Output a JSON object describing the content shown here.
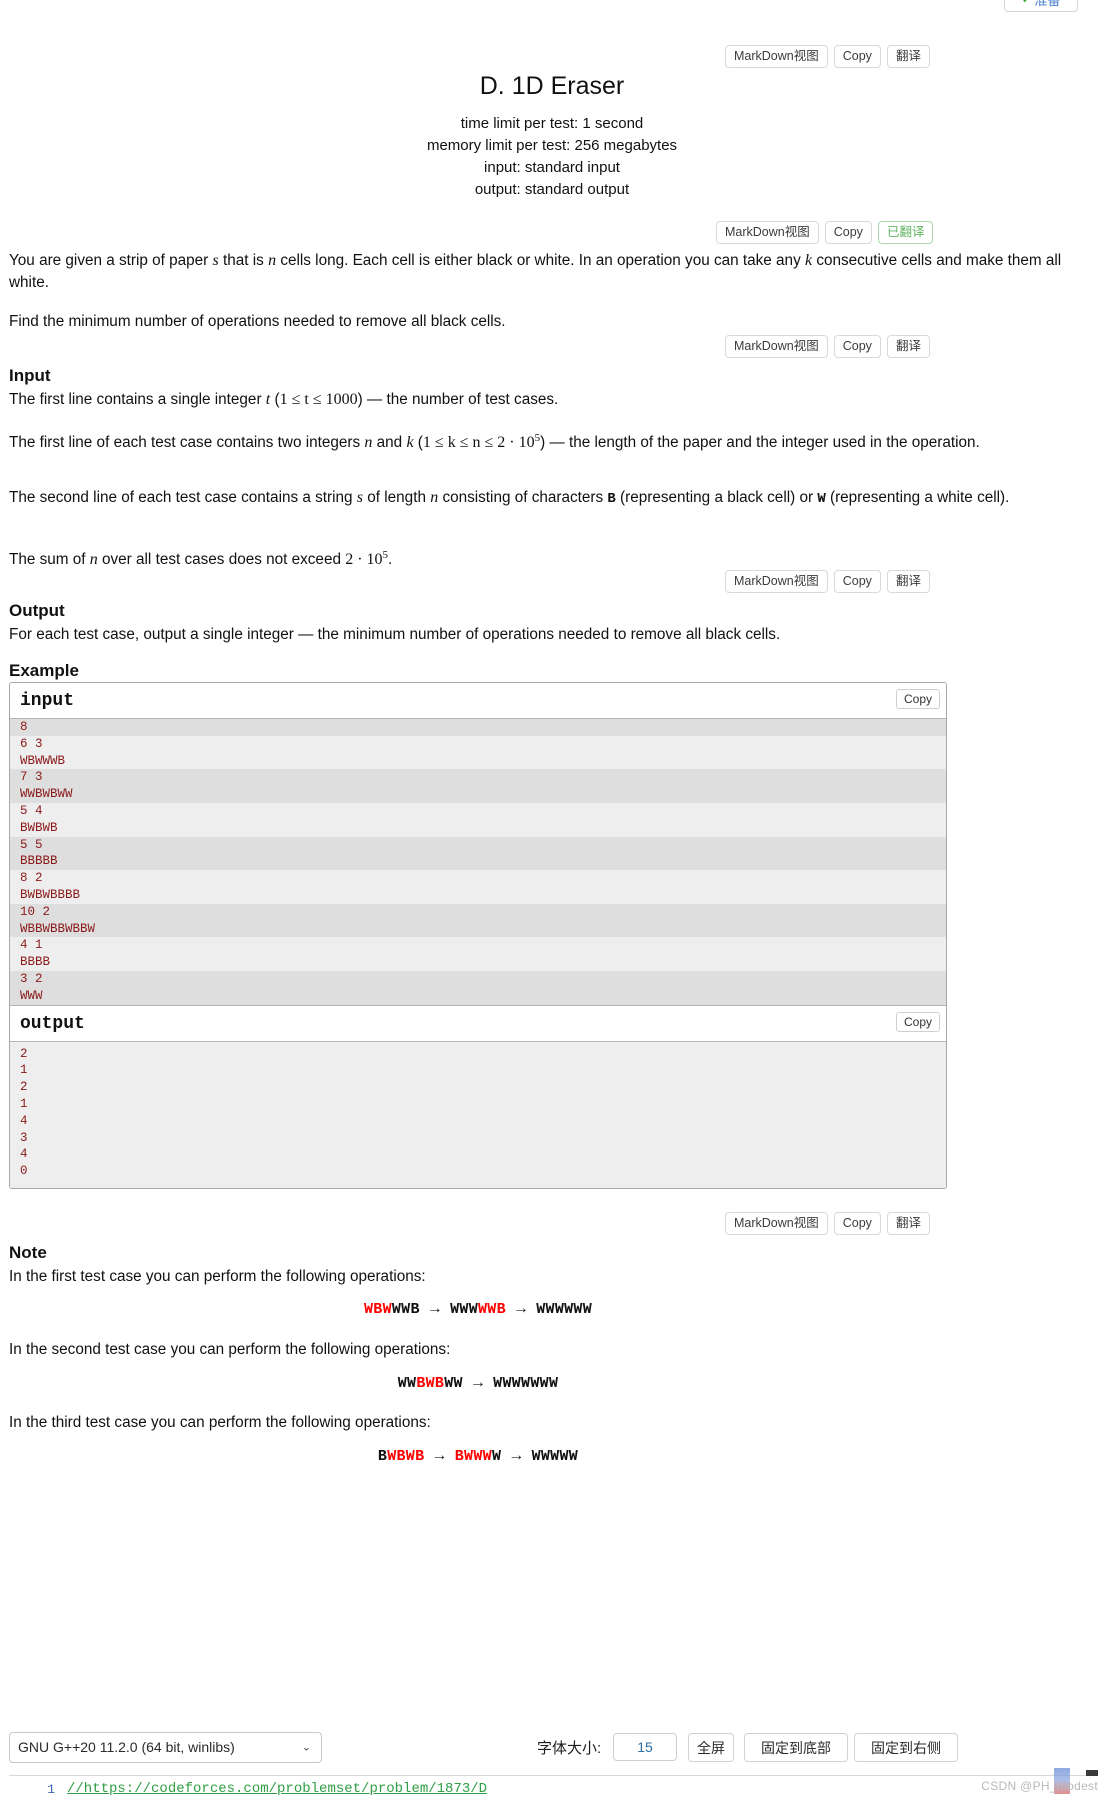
{
  "floating_button": {
    "label": "准备",
    "check": "✓"
  },
  "toolbars": {
    "markdown_label": "MarkDown视图",
    "copy_label": "Copy",
    "translate_label": "翻译",
    "translated_label": "已翻译"
  },
  "problem": {
    "title": "D. 1D Eraser",
    "time_limit": "time limit per test: 1 second",
    "memory_limit": "memory limit per test: 256 megabytes",
    "input_spec": "input: standard input",
    "output_spec": "output: standard output"
  },
  "statement": {
    "p1_a": "You are given a strip of paper ",
    "p1_s": "s",
    "p1_b": " that is ",
    "p1_n": "n",
    "p1_c": " cells long. Each cell is either black or white. In an operation you can take any ",
    "p1_k": "k",
    "p1_d": " consecutive cells and make them all white.",
    "p2": "Find the minimum number of operations needed to remove all black cells."
  },
  "input_section": {
    "heading": "Input",
    "l1_a": "The first line contains a single integer ",
    "l1_t": "t",
    "l1_b": " (",
    "l1_range": "1 ≤ t ≤ 1000",
    "l1_c": ") — the number of test cases.",
    "l2_a": "The first line of each test case contains two integers ",
    "l2_n": "n",
    "l2_b": " and ",
    "l2_k": "k",
    "l2_c": " (",
    "l2_range": "1 ≤ k ≤ n ≤ 2 · 10",
    "l2_exp": "5",
    "l2_d": ") — the length of the paper and the integer used in the operation.",
    "l3_a": "The second line of each test case contains a string ",
    "l3_s": "s",
    "l3_b": " of length ",
    "l3_n": "n",
    "l3_c": " consisting of characters ",
    "l3_B": "B",
    "l3_d": " (representing a black cell) or ",
    "l3_W": "W",
    "l3_e": " (representing a white cell).",
    "l4_a": "The sum of ",
    "l4_n": "n",
    "l4_b": " over all test cases does not exceed ",
    "l4_val": "2 · 10",
    "l4_exp": "5",
    "l4_c": "."
  },
  "output_section": {
    "heading": "Output",
    "text": "For each test case, output a single integer — the minimum number of operations needed to remove all black cells."
  },
  "example": {
    "heading": "Example",
    "input_label": "input",
    "output_label": "output",
    "copy_label": "Copy",
    "input_lines": [
      "8",
      "6 3",
      "WBWWWB",
      "7 3",
      "WWBWBWW",
      "5 4",
      "BWBWB",
      "5 5",
      "BBBBB",
      "8 2",
      "BWBWBBBB",
      "10 2",
      "WBBWBBWBBW",
      "4 1",
      "BBBB",
      "3 2",
      "WWW"
    ],
    "output_lines": [
      "2",
      "1",
      "2",
      "1",
      "4",
      "3",
      "4",
      "0"
    ]
  },
  "note_section": {
    "heading": "Note",
    "case1_text": "In the first test case you can perform the following operations:",
    "case1_formula": [
      {
        "t": "WBW",
        "c": "red"
      },
      {
        "t": "WWB",
        "c": "black"
      },
      {
        "t": "→",
        "c": "arrow"
      },
      {
        "t": "WWW",
        "c": "black"
      },
      {
        "t": "WWB",
        "c": "red"
      },
      {
        "t": "→",
        "c": "arrow"
      },
      {
        "t": "WWWWWW",
        "c": "black"
      }
    ],
    "case2_text": "In the second test case you can perform the following operations:",
    "case2_formula": [
      {
        "t": "WW",
        "c": "black"
      },
      {
        "t": "BWB",
        "c": "red"
      },
      {
        "t": "WW",
        "c": "black"
      },
      {
        "t": "→",
        "c": "arrow"
      },
      {
        "t": "WWWWWWW",
        "c": "black"
      }
    ],
    "case3_text": "In the third test case you can perform the following operations:",
    "case3_formula": [
      {
        "t": "B",
        "c": "black"
      },
      {
        "t": "WBWB",
        "c": "red"
      },
      {
        "t": "→",
        "c": "arrow"
      },
      {
        "t": "BWWW",
        "c": "red"
      },
      {
        "t": "W",
        "c": "black"
      },
      {
        "t": "→",
        "c": "arrow"
      },
      {
        "t": "WWWWW",
        "c": "black"
      }
    ]
  },
  "editor_bar": {
    "language": "GNU G++20 11.2.0 (64 bit, winlibs)",
    "caret": "⌄",
    "font_size_label": "字体大小:",
    "font_size_value": "15",
    "fullscreen_label": "全屏",
    "dock_bottom_label": "固定到底部",
    "dock_right_label": "固定到右侧"
  },
  "code": {
    "line_number": "1",
    "line_text": "//https://codeforces.com/problemset/problem/1873/D"
  },
  "watermark": {
    "text": "CSDN @PH_modest"
  },
  "colors": {
    "sample_text": "#8b1a1a",
    "highlight_red": "#ff0000",
    "accent_green": "#62b461",
    "code_comment": "#2f9e44"
  }
}
